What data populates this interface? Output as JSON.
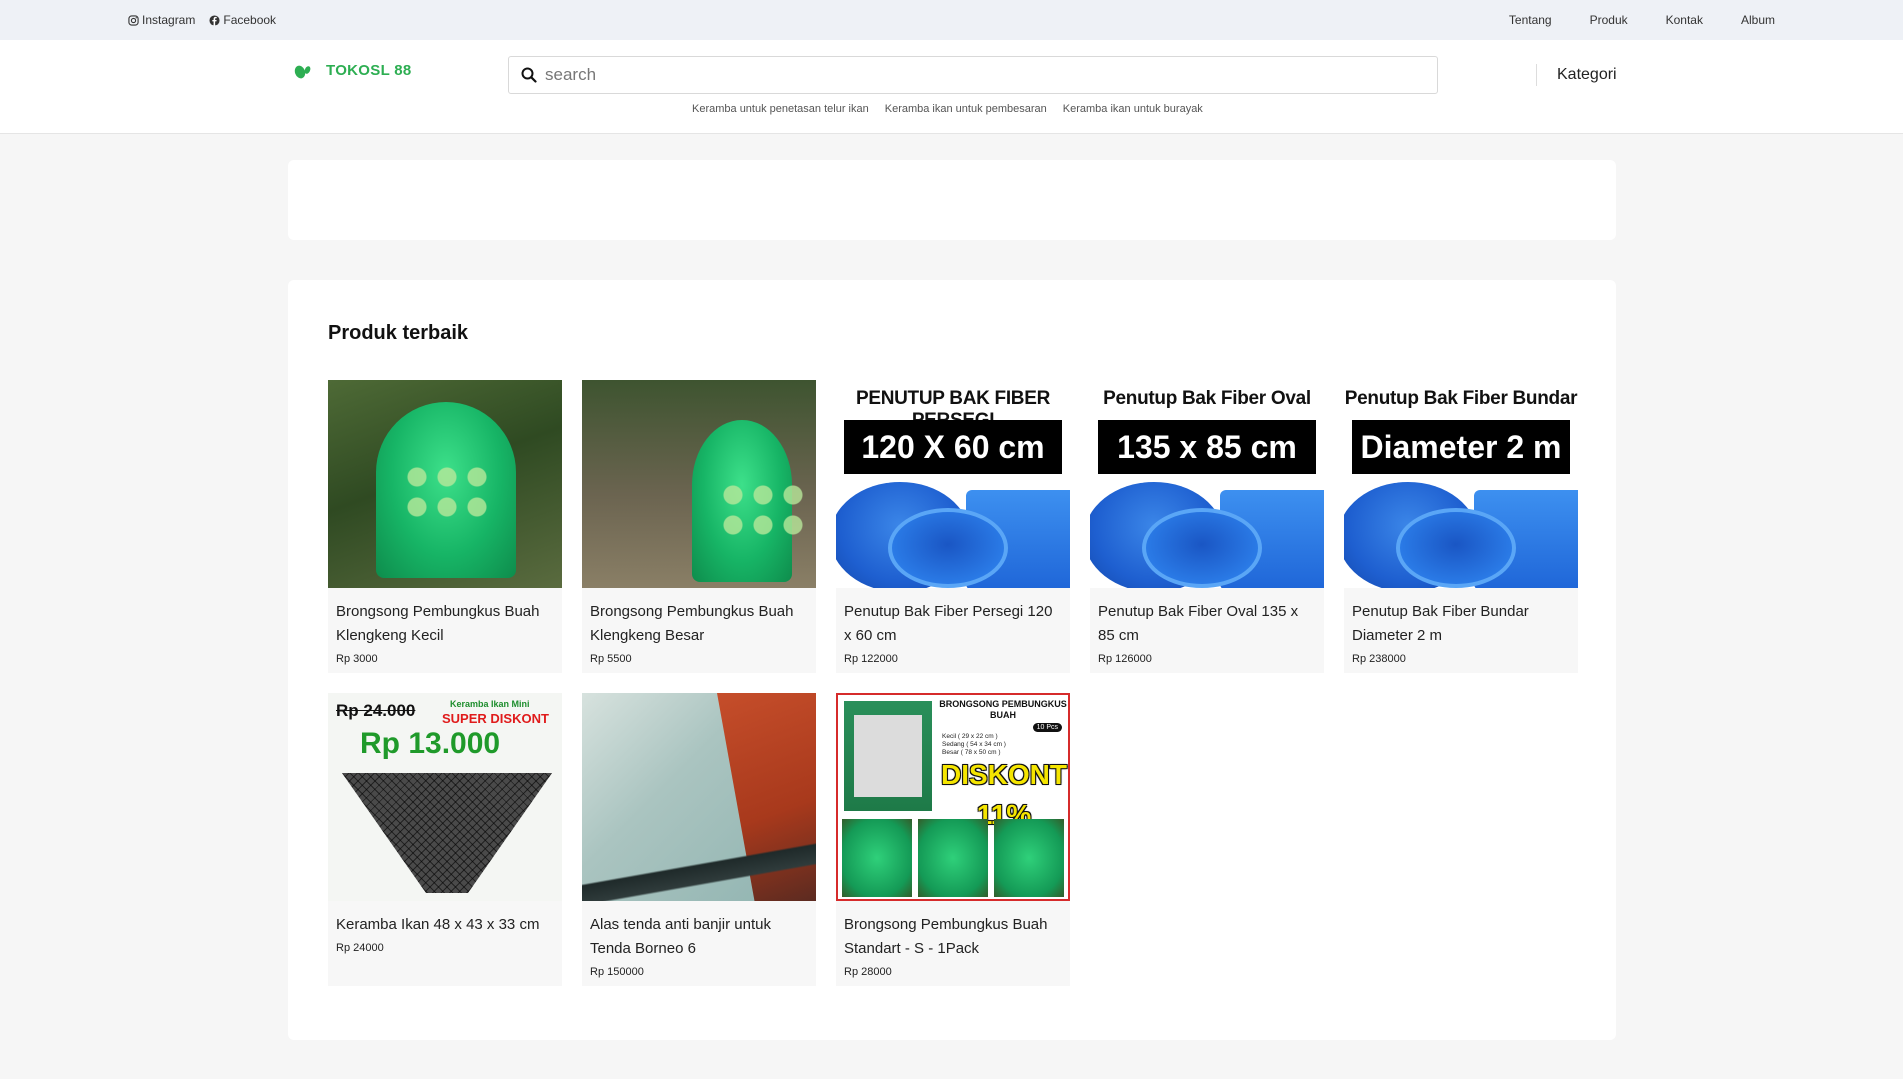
{
  "topbar": {
    "social": [
      {
        "label": "Instagram",
        "icon": "instagram-icon"
      },
      {
        "label": "Facebook",
        "icon": "facebook-icon"
      }
    ],
    "nav": [
      "Tentang",
      "Produk",
      "Kontak",
      "Album"
    ]
  },
  "header": {
    "brand": "TOKOSL 88",
    "search_placeholder": "search",
    "kategori": "Kategori",
    "suggestions": [
      "Keramba untuk penetasan telur ikan",
      "Keramba ikan untuk pembesaran",
      "Keramba ikan untuk burayak"
    ]
  },
  "colors": {
    "brand": "#2dae52",
    "topbar_bg": "#eef1f6",
    "page_bg": "#f6f6f6",
    "card_bg": "#f7f7f7"
  },
  "section": {
    "title": "Produk terbaik"
  },
  "images": {
    "p3": {
      "title": "PENUTUP BAK FIBER PERSEGI",
      "label": "120 X 60 cm"
    },
    "p4": {
      "title": "Penutup Bak Fiber Oval",
      "label": "135 x 85 cm"
    },
    "p5": {
      "title": "Penutup Bak Fiber Bundar",
      "label": "Diameter 2 m"
    },
    "p6": {
      "old": "Rp 24.000",
      "mini": "Keramba Ikan Mini",
      "super": "SUPER DISKONT",
      "price": "Rp 13.000"
    },
    "p8": {
      "title": "BRONGSONG PEMBUNGKUS BUAH",
      "pcs": "10 Pcs",
      "sizes": [
        "Kecil ( 29 x 22 cm )",
        "Sedang ( 54 x 34 cm )",
        "Besar ( 78 x 50 cm )"
      ],
      "discount": "DISKONT 11%"
    }
  },
  "products": [
    {
      "name": "Brongsong Pembungkus Buah Klengkeng Kecil",
      "price": "Rp 3000"
    },
    {
      "name": "Brongsong Pembungkus Buah Klengkeng Besar",
      "price": "Rp 5500"
    },
    {
      "name": "Penutup Bak Fiber Persegi 120 x 60 cm",
      "price": "Rp 122000"
    },
    {
      "name": "Penutup Bak Fiber Oval 135 x 85 cm",
      "price": "Rp 126000"
    },
    {
      "name": "Penutup Bak Fiber Bundar Diameter 2 m",
      "price": "Rp 238000"
    },
    {
      "name": "Keramba Ikan 48 x 43 x 33 cm",
      "price": "Rp 24000"
    },
    {
      "name": "Alas tenda anti banjir untuk Tenda Borneo 6",
      "price": "Rp 150000"
    },
    {
      "name": "Brongsong Pembungkus Buah Standart - S - 1Pack",
      "price": "Rp 28000"
    }
  ]
}
